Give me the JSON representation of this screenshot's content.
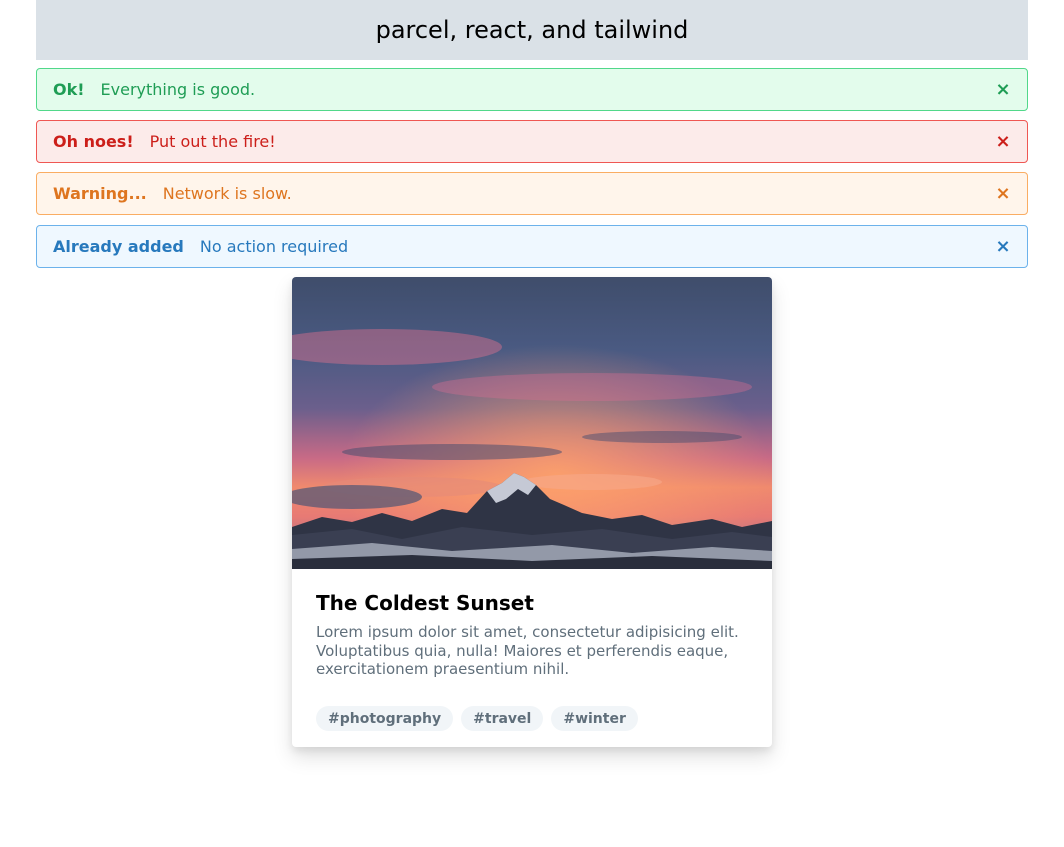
{
  "header": {
    "title": "parcel, react, and tailwind"
  },
  "alerts": [
    {
      "title": "Ok!",
      "message": "Everything is good.",
      "close": "×"
    },
    {
      "title": "Oh noes!",
      "message": "Put out the fire!",
      "close": "×"
    },
    {
      "title": "Warning...",
      "message": "Network is slow.",
      "close": "×"
    },
    {
      "title": "Already added",
      "message": "No action required",
      "close": "×"
    }
  ],
  "card": {
    "image_icon": "mountain-sunset-image",
    "title": "The Coldest Sunset",
    "text": "Lorem ipsum dolor sit amet, consectetur adipisicing elit. Voluptatibus quia, nulla! Maiores et perferendis eaque, exercitationem praesentium nihil.",
    "tags": [
      "#photography",
      "#travel",
      "#winter"
    ]
  },
  "colors": {
    "ok": "#1f9d55",
    "error": "#cc1f1a",
    "warning": "#de751f",
    "info": "#2779bd",
    "header_bg": "#dae1e7"
  }
}
